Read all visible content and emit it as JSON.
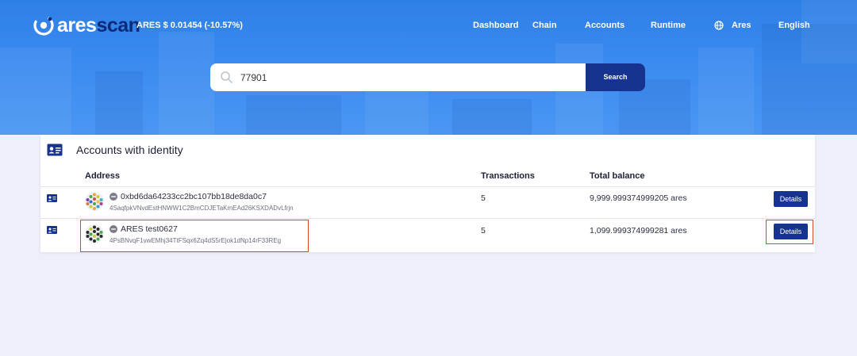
{
  "header": {
    "logo": {
      "part1": "ares",
      "part2": "scan"
    },
    "price": "ARES $ 0.01454 (-10.57%)",
    "nav": [
      {
        "label": "Dashboard"
      },
      {
        "label": "Chain"
      },
      {
        "label": "Accounts"
      },
      {
        "label": "Runtime"
      },
      {
        "label": "Ares"
      },
      {
        "label": "English"
      }
    ]
  },
  "search": {
    "value": "77901",
    "button_label": "Search"
  },
  "table": {
    "title": "Accounts with identity",
    "columns": [
      "Address",
      "Transactions",
      "Total balance"
    ],
    "rows": [
      {
        "name": "0xbd6da64233cc2bc107bb18de8da0c7",
        "address": "4SaqfpkVNvdEstHNWW1C2BmCDJETaKmEAd26KSXDADvLfrjn",
        "transactions": "5",
        "balance": "9,999.999374999205 ares",
        "action": "Details"
      },
      {
        "name": "ARES test0627",
        "address": "4PsBNvqF1vwEMhj34TtFSqx6Zq4dS5rEjok1dNp14rF33REg",
        "transactions": "5",
        "balance": "1,099.999374999281 ares",
        "action": "Details"
      }
    ]
  },
  "colors": {
    "accent": "#15338f",
    "hero": "#3a8bf0",
    "highlight": "#d9482a"
  }
}
